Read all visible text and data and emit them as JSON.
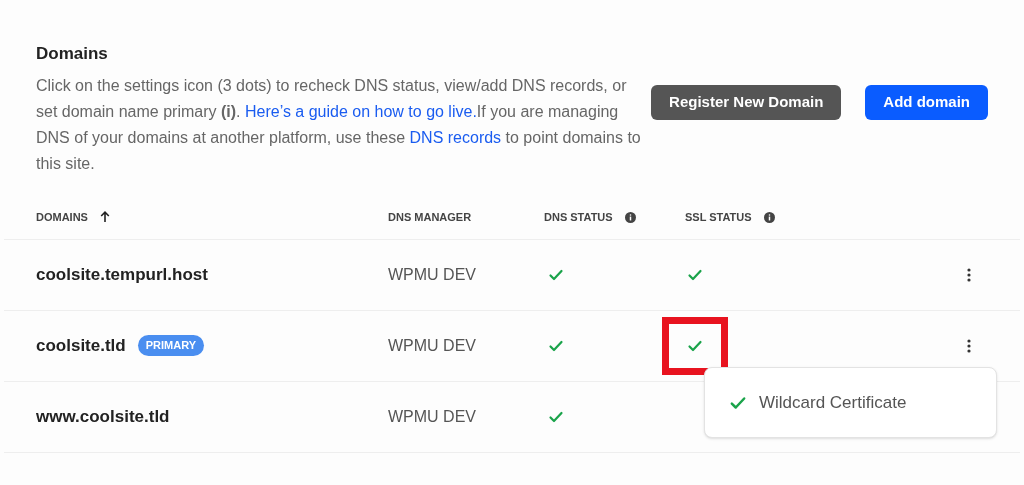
{
  "section": {
    "title": "Domains",
    "description": [
      {
        "kind": "text",
        "text": "Click on the settings icon (3 dots) to recheck DNS status, view/add DNS records, or set domain name primary **(i)**. "
      },
      {
        "kind": "link",
        "text": "Here’s a guide on how to go live."
      },
      {
        "kind": "text",
        "text": "If you are managing DNS of your domains at another platform, use these "
      },
      {
        "kind": "link",
        "text": "DNS records"
      },
      {
        "kind": "text",
        "text": " to point domains to this site."
      }
    ]
  },
  "buttons": [
    {
      "label": "Register New Domain",
      "kind": "secondary"
    },
    {
      "label": "Add domain",
      "kind": "primary"
    }
  ],
  "table": {
    "columns": [
      {
        "label": "DOMAINS",
        "sorted": true,
        "info": false
      },
      {
        "label": "DNS MANAGER",
        "sorted": false,
        "info": false
      },
      {
        "label": "DNS STATUS",
        "sorted": false,
        "info": true
      },
      {
        "label": "SSL STATUS",
        "sorted": false,
        "info": true
      }
    ],
    "rows": [
      {
        "domain": "coolsite.tempurl.host",
        "badge": "",
        "manager": "WPMU DEV",
        "dns_ok": true,
        "ssl": {
          "ok": true,
          "highlighted": false
        },
        "menu": true
      },
      {
        "domain": "coolsite.tld",
        "badge": "PRIMARY",
        "manager": "WPMU DEV",
        "dns_ok": true,
        "ssl": {
          "ok": true,
          "highlighted": true
        },
        "menu": true
      },
      {
        "domain": "www.coolsite.tld",
        "badge": "",
        "manager": "WPMU DEV",
        "dns_ok": true,
        "ssl": null,
        "menu": false
      }
    ]
  },
  "tooltip": {
    "text": "Wildcard Certificate",
    "ok": true
  }
}
